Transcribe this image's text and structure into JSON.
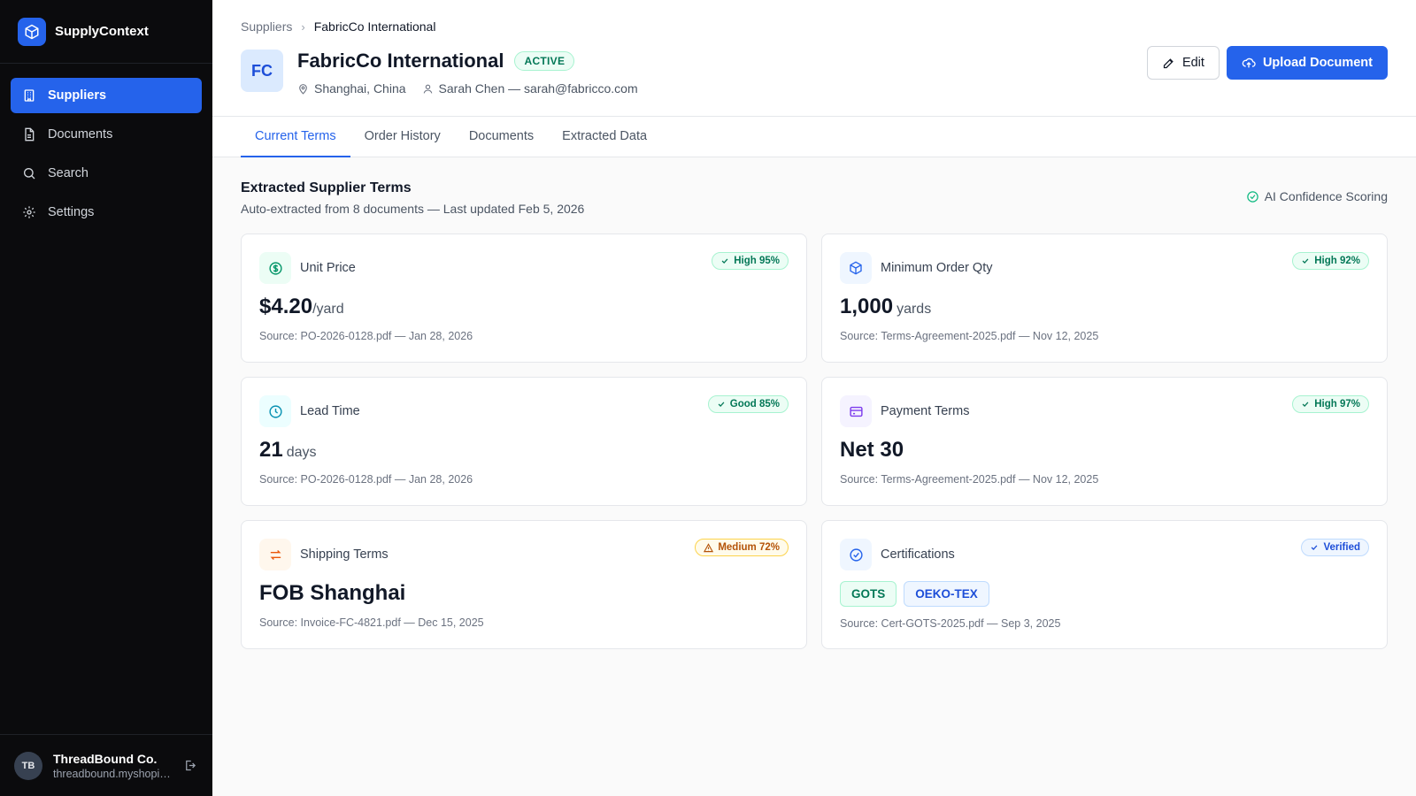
{
  "brand": {
    "name": "SupplyContext",
    "logo_icon": "cube-icon"
  },
  "nav": [
    {
      "label": "Suppliers",
      "icon": "building-icon",
      "active": true
    },
    {
      "label": "Documents",
      "icon": "document-icon",
      "active": false
    },
    {
      "label": "Search",
      "icon": "search-icon",
      "active": false
    },
    {
      "label": "Settings",
      "icon": "gear-icon",
      "active": false
    }
  ],
  "account": {
    "initials": "TB",
    "name": "ThreadBound Co.",
    "sub": "threadbound.myshopify.com"
  },
  "breadcrumb": {
    "parent": "Suppliers",
    "current": "FabricCo International"
  },
  "supplier": {
    "initials": "FC",
    "name": "FabricCo International",
    "status": "ACTIVE",
    "location": "Shanghai, China",
    "contact": "Sarah Chen — sarah@fabricco.com"
  },
  "actions": {
    "edit": "Edit",
    "upload": "Upload Document"
  },
  "tabs": [
    {
      "label": "Current Terms",
      "active": true
    },
    {
      "label": "Order History",
      "active": false
    },
    {
      "label": "Documents",
      "active": false
    },
    {
      "label": "Extracted Data",
      "active": false
    }
  ],
  "section": {
    "title": "Extracted Supplier Terms",
    "subtitle": "Auto-extracted from 8 documents — Last updated Feb 5, 2026",
    "ai_label": "AI Confidence Scoring"
  },
  "cards": {
    "unit_price": {
      "label": "Unit Price",
      "value": "$4.20",
      "unit": "/yard",
      "confidence": "High 95%",
      "source": "Source: PO-2026-0128.pdf — Jan 28, 2026"
    },
    "moq": {
      "label": "Minimum Order Qty",
      "value": "1,000",
      "unit": "yards",
      "confidence": "High 92%",
      "source": "Source: Terms-Agreement-2025.pdf — Nov 12, 2025"
    },
    "lead_time": {
      "label": "Lead Time",
      "value": "21",
      "unit": "days",
      "confidence": "Good 85%",
      "source": "Source: PO-2026-0128.pdf — Jan 28, 2026"
    },
    "payment": {
      "label": "Payment Terms",
      "value": "Net 30",
      "confidence": "High 97%",
      "source": "Source: Terms-Agreement-2025.pdf — Nov 12, 2025"
    },
    "shipping": {
      "label": "Shipping Terms",
      "value": "FOB Shanghai",
      "confidence": "Medium 72%",
      "source": "Source: Invoice-FC-4821.pdf — Dec 15, 2025"
    },
    "certs": {
      "label": "Certifications",
      "badge": "Verified",
      "chips": [
        "GOTS",
        "OEKO-TEX"
      ],
      "source": "Source: Cert-GOTS-2025.pdf — Sep 3, 2025"
    }
  },
  "colors": {
    "accent": "#2563eb",
    "sidebar_bg": "#0b0b0d",
    "success": "#047857",
    "warning": "#b45309"
  }
}
